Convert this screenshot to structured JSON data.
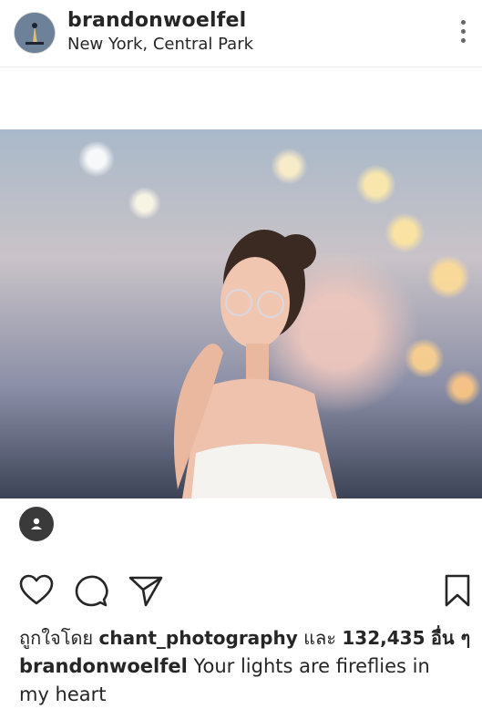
{
  "post": {
    "username": "brandonwoelfel",
    "location": "New York, Central Park"
  },
  "likes": {
    "prefix": "ถูกใจโดย",
    "liker": "chant_photography",
    "conjunction": "และ",
    "count": "132,435",
    "suffix": "อื่น ๆ"
  },
  "caption": {
    "username": "brandonwoelfel",
    "text": "Your lights are fireflies in my heart"
  },
  "icons": {
    "more": "more-vertical-icon",
    "tag": "person-tag-icon",
    "like": "heart-icon",
    "comment": "comment-icon",
    "share": "send-icon",
    "save": "bookmark-icon"
  },
  "colors": {
    "text": "#262626",
    "divider": "#efefef",
    "tag_badge": "#3a3a3a"
  }
}
